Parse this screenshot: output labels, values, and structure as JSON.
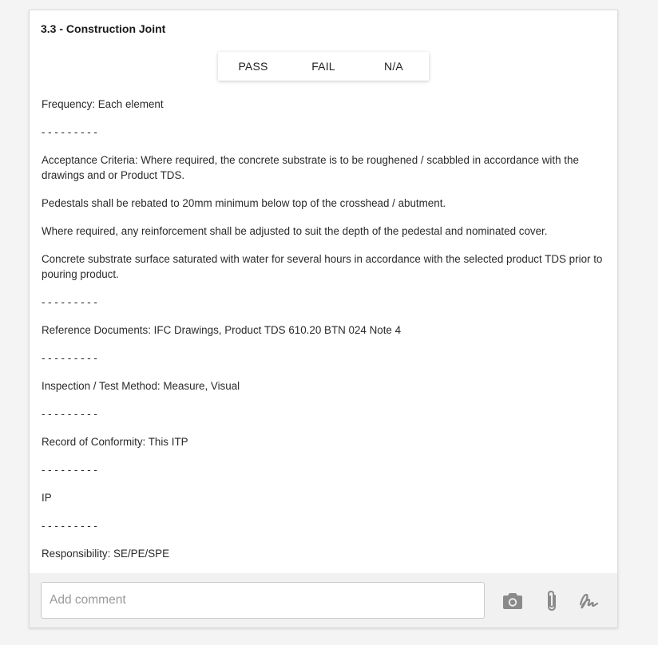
{
  "section": {
    "title": "3.3 - Construction Joint"
  },
  "result_options": [
    "PASS",
    "FAIL",
    "N/A"
  ],
  "body": {
    "frequency": "Frequency: Each element",
    "divider": "- - - - - - - - -",
    "acceptance": "Acceptance Criteria: Where required, the concrete substrate is to be roughened / scabbled in accordance with the drawings and or Product TDS.",
    "pedestals": "Pedestals shall be rebated to 20mm minimum below top of the crosshead / abutment.",
    "reinforcement": "Where required, any reinforcement shall be adjusted to suit the depth of the pedestal and nominated cover.",
    "substrate": "Concrete substrate surface saturated with water for several hours in accordance with the selected product TDS prior to pouring product.",
    "reference": "Reference Documents: IFC Drawings, Product TDS 610.20 BTN 024 Note 4",
    "inspection": "Inspection / Test Method: Measure, Visual",
    "record": "Record of Conformity: This ITP",
    "ip": "IP",
    "responsibility": "Responsibility: SE/PE/SPE"
  },
  "footer": {
    "comment_placeholder": "Add comment",
    "icons": [
      "camera-icon",
      "paperclip-icon",
      "signature-icon"
    ],
    "icon_color": "#8a8a8a"
  }
}
